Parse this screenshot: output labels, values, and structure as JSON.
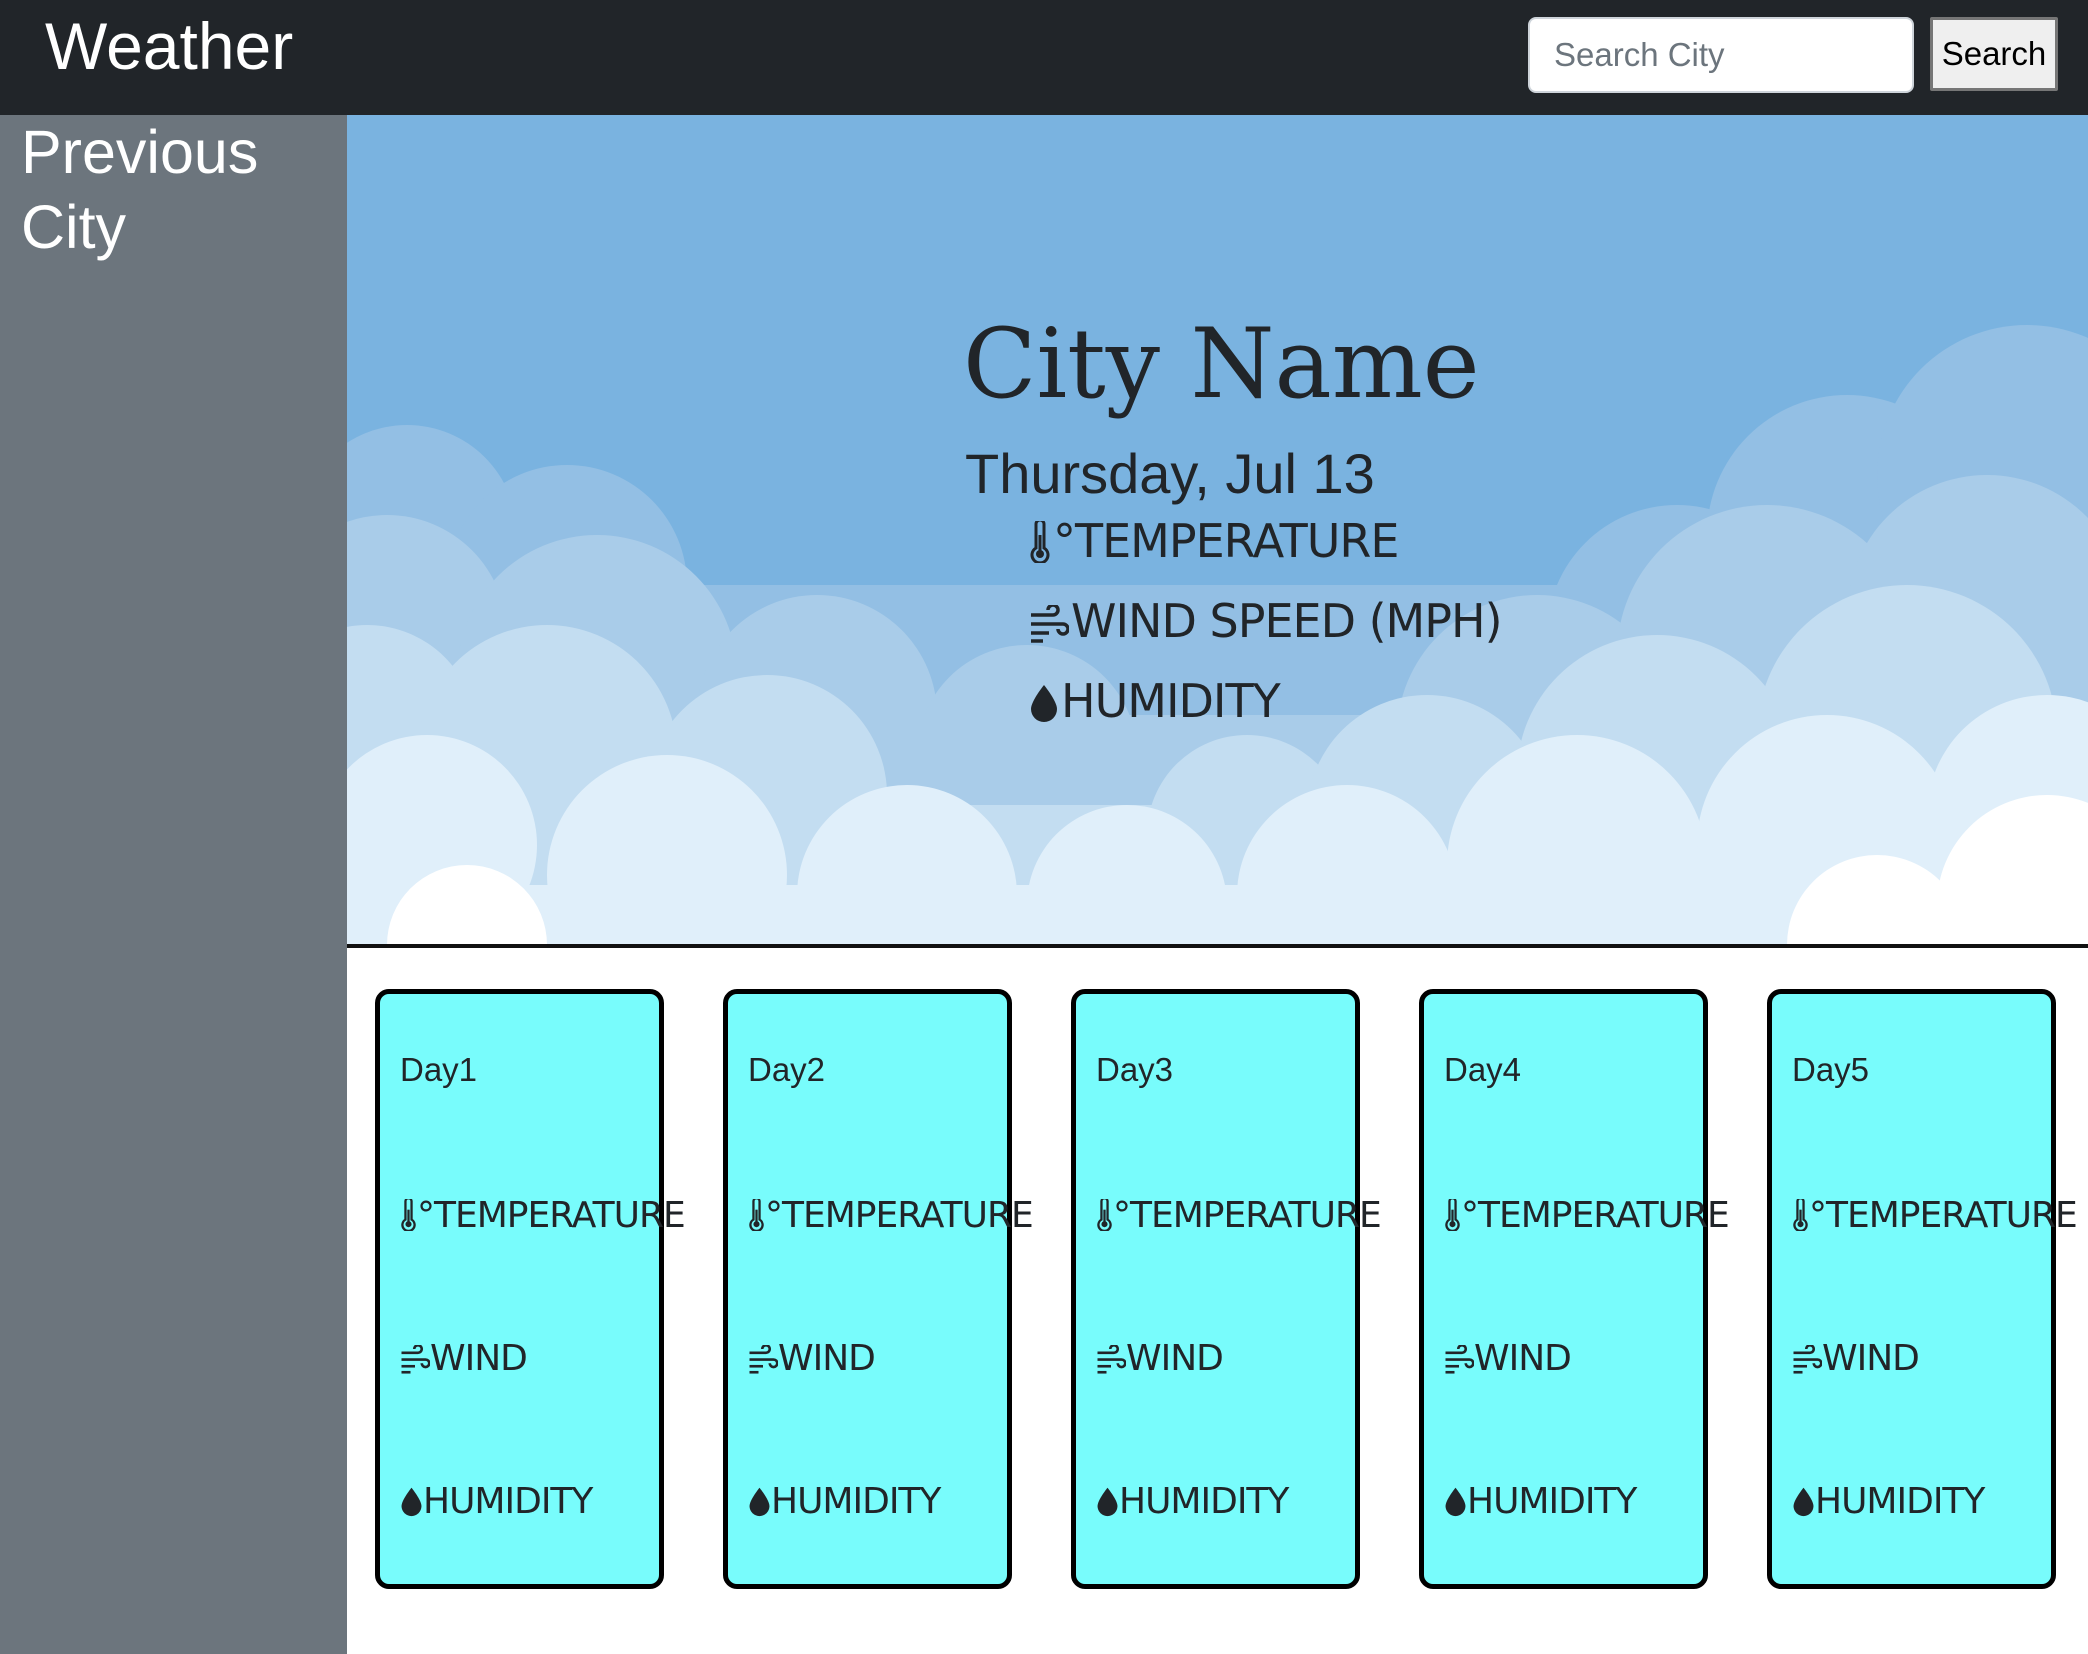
{
  "navbar": {
    "brand": "Weather",
    "search_placeholder": "Search City",
    "search_button": "Search"
  },
  "sidebar": {
    "title": "Previous City"
  },
  "current": {
    "city_name": "City Name",
    "date": "Thursday, Jul 13",
    "temperature_label": "°TEMPERATURE",
    "wind_label": "WIND SPEED (MPH)",
    "humidity_label": "HUMIDITY"
  },
  "forecast": {
    "days": [
      {
        "day": "Day1",
        "temperature": "°TEMPERATURE",
        "wind": "WIND",
        "humidity": "HUMIDITY"
      },
      {
        "day": "Day2",
        "temperature": "°TEMPERATURE",
        "wind": "WIND",
        "humidity": "HUMIDITY"
      },
      {
        "day": "Day3",
        "temperature": "°TEMPERATURE",
        "wind": "WIND",
        "humidity": "HUMIDITY"
      },
      {
        "day": "Day4",
        "temperature": "°TEMPERATURE",
        "wind": "WIND",
        "humidity": "HUMIDITY"
      },
      {
        "day": "Day5",
        "temperature": "°TEMPERATURE",
        "wind": "WIND",
        "humidity": "HUMIDITY"
      }
    ]
  },
  "icons": {
    "temperature": "thermometer-icon",
    "wind": "wind-icon",
    "humidity": "droplet-icon"
  },
  "colors": {
    "navbar": "#212529",
    "sidebar": "#6c757d",
    "sky": "#7ab3e0",
    "card": "#78fcfc",
    "card_border": "#000000"
  }
}
